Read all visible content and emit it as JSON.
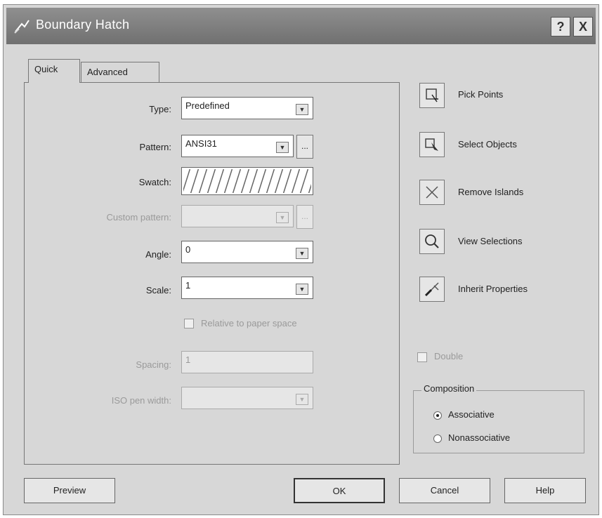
{
  "window": {
    "title": "Boundary Hatch",
    "help_glyph": "?",
    "close_glyph": "X"
  },
  "tabs": [
    {
      "label": "Quick"
    },
    {
      "label": "Advanced"
    }
  ],
  "form": {
    "type": {
      "label": "Type:",
      "value": "Predefined"
    },
    "pattern": {
      "label": "Pattern:",
      "value": "ANSI31"
    },
    "swatch": {
      "label": "Swatch:"
    },
    "custom_pattern": {
      "label": "Custom pattern:",
      "value": ""
    },
    "angle": {
      "label": "Angle:",
      "value": "0"
    },
    "scale": {
      "label": "Scale:",
      "value": "1"
    },
    "relative": {
      "label": "Relative to paper space"
    },
    "spacing": {
      "label": "Spacing:",
      "value": "1"
    },
    "iso_pen_width": {
      "label": "ISO pen width:",
      "value": ""
    },
    "ellipsis": "...",
    "dropdown_glyph": "▼"
  },
  "actions": {
    "pick_points": "Pick Points",
    "select_objects": "Select Objects",
    "remove_islands": "Remove Islands",
    "view_selections": "View Selections",
    "inherit_properties": "Inherit Properties"
  },
  "double": {
    "label": "Double"
  },
  "composition": {
    "title": "Composition",
    "associative": "Associative",
    "nonassociative": "Nonassociative",
    "selected": "associative"
  },
  "buttons": {
    "preview": "Preview",
    "ok": "OK",
    "cancel": "Cancel",
    "help": "Help"
  }
}
